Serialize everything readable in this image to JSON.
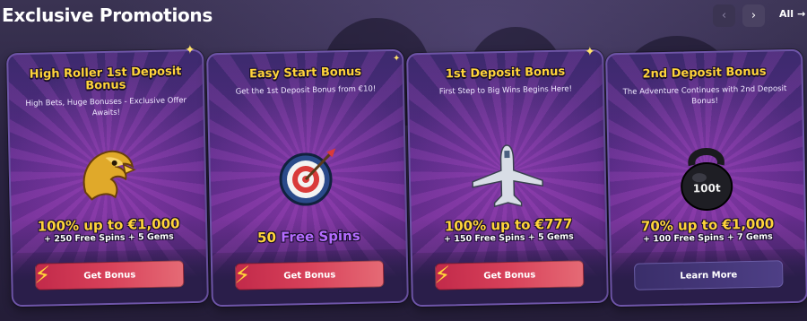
{
  "header": {
    "title": "Exclusive Promotions",
    "prev_icon": "chevron-left-icon",
    "next_icon": "chevron-right-icon",
    "all_label": "All",
    "all_icon": "arrow-right-icon"
  },
  "colors": {
    "accent_gold": "#ffd43a",
    "accent_violet": "#b56cff",
    "cta_red": "#d8415a",
    "cta_purple": "#4e3f86"
  },
  "cards": [
    {
      "title": "High Roller 1st Deposit Bonus",
      "subtitle": "High Bets, Huge Bonuses - Exclusive Offer Awaits!",
      "art": "eagle-icon",
      "offer_prefix": "100% ",
      "offer_highlight": "up to €1,000",
      "offer_extra": "+ 250 Free Spins + 5 Gems",
      "cta": "Get Bonus"
    },
    {
      "title": "Easy Start Bonus",
      "subtitle": "Get the 1st Deposit Bonus from €10!",
      "art": "target-icon",
      "offer_prefix": "50 ",
      "offer_highlight": "Free Spins",
      "offer_extra": "",
      "cta": "Get Bonus"
    },
    {
      "title": "1st Deposit Bonus",
      "subtitle": "First Step to Big Wins Begins Here!",
      "art": "airplane-icon",
      "offer_prefix": "100% ",
      "offer_highlight": "up to €777",
      "offer_extra": "+ 150 Free Spins + 5 Gems",
      "cta": "Get Bonus"
    },
    {
      "title": "2nd Deposit Bonus",
      "subtitle": "The Adventure Continues with 2nd Deposit Bonus!",
      "art": "kettlebell-icon",
      "art_text": "100t",
      "offer_prefix": "70% ",
      "offer_highlight": "up to €1,000",
      "offer_extra": "+ 100 Free Spins + 7 Gems",
      "cta": "Learn More"
    }
  ]
}
